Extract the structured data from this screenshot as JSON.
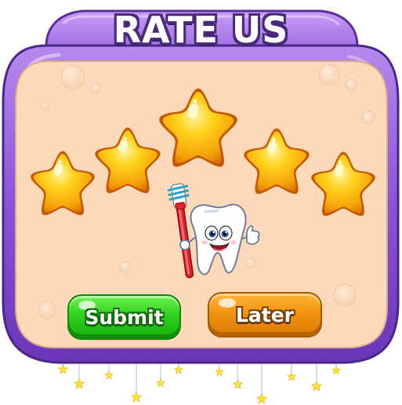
{
  "dialog": {
    "title": "RATE US",
    "rating": {
      "filled_stars": 5,
      "max_stars": 5
    },
    "buttons": {
      "submit_label": "Submit",
      "later_label": "Later"
    },
    "colors": {
      "frame_purple": "#8a55d6",
      "panel_peach": "#fbd9b9",
      "star_gold": "#ffc21a",
      "submit_green": "#2fd21e",
      "later_orange": "#f29412"
    },
    "icons": [
      "star-icon",
      "tooth-mascot-icon",
      "toothbrush-icon"
    ]
  }
}
